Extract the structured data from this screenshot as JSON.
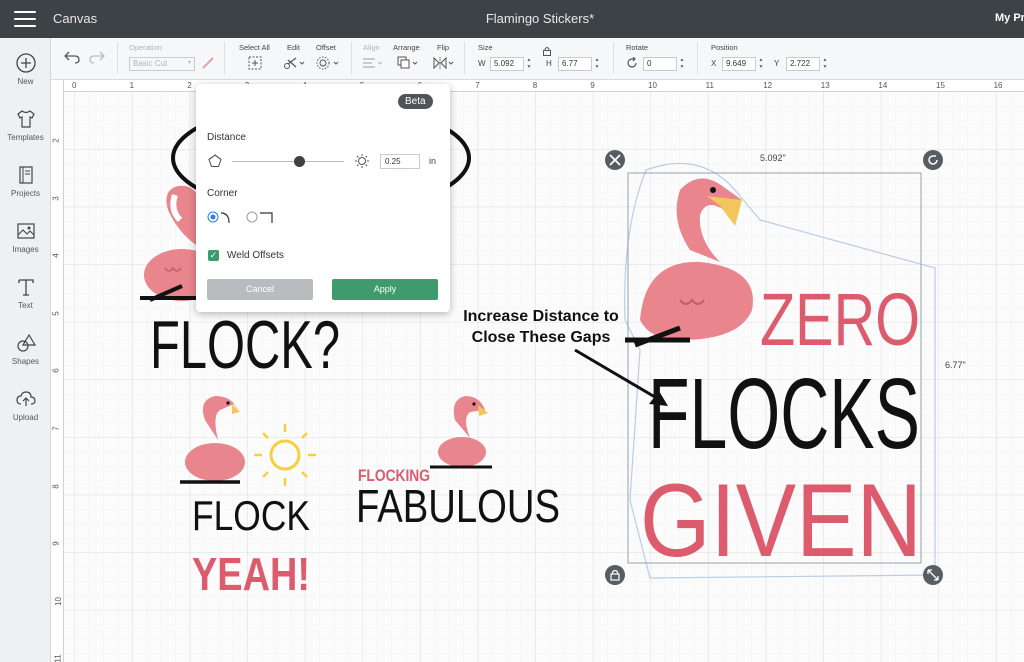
{
  "topbar": {
    "app_name": "Canvas",
    "document_title": "Flamingo Stickers*",
    "projects_link": "My Pro"
  },
  "sidebar": {
    "items": [
      {
        "label": "New",
        "icon": "plus-circle-icon"
      },
      {
        "label": "Templates",
        "icon": "shirt-icon"
      },
      {
        "label": "Projects",
        "icon": "book-icon"
      },
      {
        "label": "Images",
        "icon": "image-icon"
      },
      {
        "label": "Text",
        "icon": "text-t-icon"
      },
      {
        "label": "Shapes",
        "icon": "shapes-icon"
      },
      {
        "label": "Upload",
        "icon": "cloud-upload-icon"
      }
    ]
  },
  "toolbar": {
    "operation_label": "Operation",
    "operation_value": "Basic Cut",
    "select_all_label": "Select All",
    "edit_label": "Edit",
    "offset_label": "Offset",
    "align_label": "Align",
    "arrange_label": "Arrange",
    "flip_label": "Flip",
    "size_label": "Size",
    "w_label": "W",
    "w_value": "5.092",
    "h_label": "H",
    "h_value": "6.77",
    "rotate_label": "Rotate",
    "rotate_value": "0",
    "position_label": "Position",
    "x_label": "X",
    "x_value": "9.649",
    "y_label": "Y",
    "y_value": "2.722"
  },
  "rulers": {
    "top": [
      "0",
      "1",
      "2",
      "3",
      "4",
      "5",
      "6",
      "7",
      "8",
      "9",
      "10",
      "11",
      "12",
      "13",
      "14",
      "15",
      "16"
    ],
    "left": [
      "2",
      "3",
      "4",
      "5",
      "6",
      "7",
      "8",
      "9",
      "10",
      "11"
    ]
  },
  "offset_panel": {
    "badge": "Beta",
    "distance_label": "Distance",
    "distance_value": "0.25",
    "distance_fraction": 0.6,
    "unit": "in",
    "corner_label": "Corner",
    "corner_selected": "rounded",
    "weld_label": "Weld Offsets",
    "weld_checked": true,
    "cancel_label": "Cancel",
    "apply_label": "Apply"
  },
  "canvas": {
    "annotation": "Increase Distance to Close These Gaps",
    "annotation_line1": "Increase Distance to",
    "annotation_line2": "Close These Gaps",
    "width_readout": "5.092\"",
    "height_readout": "6.77\"",
    "designs": {
      "flock_text": "FLOCK?",
      "flock_yeah_top": "FLOCK",
      "flock_yeah_bottom": "YEAH!",
      "flocking": "FLOCKING",
      "fabulous": "FABULOUS",
      "zero": "ZERO",
      "flocks": "FLOCKS",
      "given": "GIVEN"
    },
    "colors": {
      "flamingo_pink": "#e8858d",
      "flamingo_dark": "#d96e78",
      "beak": "#f2c65a",
      "text_pink": "#dc5c6e",
      "sun": "#f4d03f",
      "offset_outline": "#b9cde6"
    }
  }
}
